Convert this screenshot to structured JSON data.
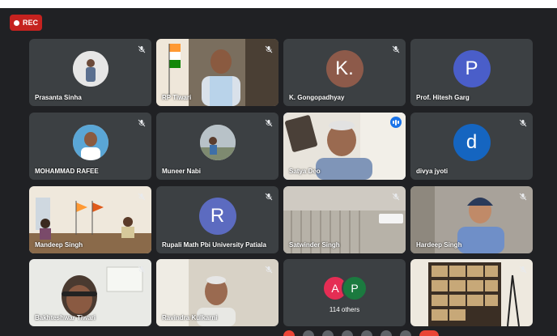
{
  "recording": {
    "label": "REC"
  },
  "tiles": [
    {
      "name": "Prasanta Sinha"
    },
    {
      "name": "RP Tiwari"
    },
    {
      "name": "K. Gongopadhyay",
      "initial": "K.",
      "color": "#8d5a4a"
    },
    {
      "name": "Prof. Hitesh Garg",
      "initial": "P",
      "color": "#4a5ec9"
    },
    {
      "name": "MOHAMMAD RAFEE"
    },
    {
      "name": "Muneer Nabi"
    },
    {
      "name": "Satya Deo"
    },
    {
      "name": "divya jyoti",
      "initial": "d",
      "color": "#1565c0"
    },
    {
      "name": "Mandeep Singh"
    },
    {
      "name": "Rupali Math Pbi University Patiala",
      "initial": "R",
      "color": "#5c6bc0"
    },
    {
      "name": "Satwinder Singh"
    },
    {
      "name": "Hardeep Singh"
    },
    {
      "name": "Bakhteshwar Tiwari"
    },
    {
      "name": "Ravindra Kulkarni"
    },
    {
      "others_label": "114 others",
      "avatars": [
        {
          "initial": "A",
          "color": "#e52d54"
        },
        {
          "initial": "P",
          "color": "#1b7a3f"
        }
      ]
    },
    {
      "name": ""
    }
  ],
  "icons": {
    "mic_off": "mic-off-icon",
    "speaking": "speaking-indicator-icon"
  }
}
